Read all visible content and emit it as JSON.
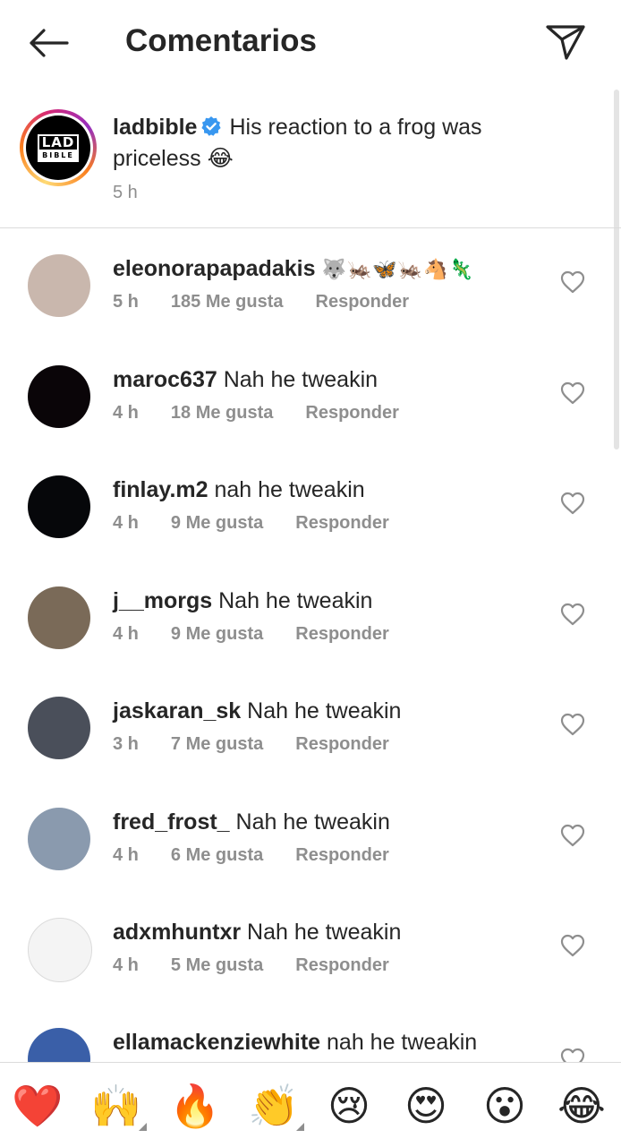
{
  "header": {
    "title": "Comentarios"
  },
  "caption": {
    "username": "ladbible",
    "text": "His reaction to a frog was priceless 😂",
    "time": "5 h",
    "logo_top": "LAD",
    "logo_bottom": "BIBLE"
  },
  "comments": [
    {
      "username": "eleonorapapadakis",
      "text": "🐺🦗🦋🦗🐴🦎",
      "time": "5 h",
      "likes": "185 Me gusta",
      "reply": "Responder",
      "avatar_color": "#c9b7ad"
    },
    {
      "username": "maroc637",
      "text": "Nah he tweakin",
      "time": "4 h",
      "likes": "18 Me gusta",
      "reply": "Responder",
      "avatar_color": "#0a0508"
    },
    {
      "username": "finlay.m2",
      "text": "nah he tweakin",
      "time": "4 h",
      "likes": "9 Me gusta",
      "reply": "Responder",
      "avatar_color": "#06070a"
    },
    {
      "username": "j__morgs",
      "text": "Nah he tweakin",
      "time": "4 h",
      "likes": "9 Me gusta",
      "reply": "Responder",
      "avatar_color": "#7a6a58"
    },
    {
      "username": "jaskaran_sk",
      "text": "Nah he tweakin",
      "time": "3 h",
      "likes": "7 Me gusta",
      "reply": "Responder",
      "avatar_color": "#4a4f5a"
    },
    {
      "username": "fred_frost_",
      "text": "Nah he tweakin",
      "time": "4 h",
      "likes": "6 Me gusta",
      "reply": "Responder",
      "avatar_color": "#8a9aae"
    },
    {
      "username": "adxmhuntxr",
      "text": "Nah he tweakin",
      "time": "4 h",
      "likes": "5 Me gusta",
      "reply": "Responder",
      "avatar_color": "#f4f4f4"
    },
    {
      "username": "ellamackenziewhite",
      "text": "nah he tweakin",
      "time": "",
      "likes": "",
      "reply": "",
      "avatar_color": "#3a5fa8"
    }
  ],
  "emoji_bar": [
    "❤️",
    "🙌",
    "🔥",
    "👏",
    "😢",
    "😍",
    "😮",
    "😂"
  ],
  "colors": {
    "text": "#262626",
    "secondary": "#8e8e8e",
    "verified": "#3897f0",
    "divider": "#dbdbdb"
  }
}
